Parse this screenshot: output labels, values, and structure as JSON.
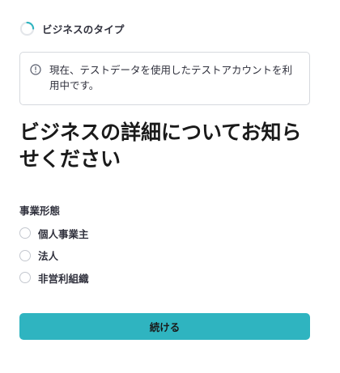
{
  "step": {
    "label": "ビジネスのタイプ",
    "icon": "loading-spinner-icon",
    "accent_color": "#2fb4c0"
  },
  "notice": {
    "icon": "info-icon",
    "text": "現在、テストデータを使用したテストアカウントを利用中です。"
  },
  "title": "ビジネスの詳細についてお知らせください",
  "business_type": {
    "label": "事業形態",
    "options": [
      {
        "label": "個人事業主",
        "selected": false
      },
      {
        "label": "法人",
        "selected": false
      },
      {
        "label": "非営利組織",
        "selected": false
      }
    ]
  },
  "continue_button": {
    "label": "続ける",
    "color": "#2fb4c0"
  }
}
